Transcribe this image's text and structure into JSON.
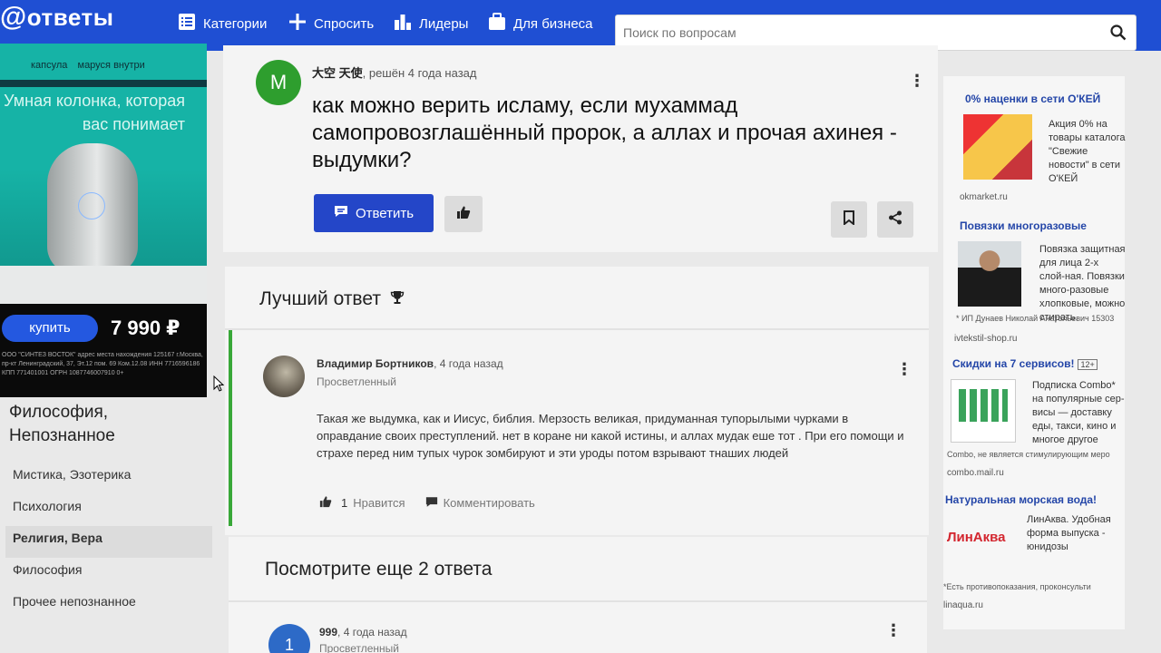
{
  "header": {
    "logo_symbol": "@",
    "logo_text": "ответы",
    "nav": [
      {
        "label": "Категории",
        "icon": "list-icon"
      },
      {
        "label": "Спросить",
        "icon": "plus-icon"
      },
      {
        "label": "Лидеры",
        "icon": "bars-icon"
      },
      {
        "label": "Для бизнеса",
        "icon": "briefcase-icon"
      }
    ],
    "search_placeholder": "Поиск по вопросам",
    "accent": "#1f4fd3"
  },
  "left_ad": {
    "brand1": "капсула",
    "brand2": "маруся внутри",
    "title": "Умная колонка, которая вас понимает",
    "buy_label": "купить",
    "price": "7 990 ₽",
    "legal": "ООО \"СИНТЕЗ ВОСТОК\" адрес места нахождения 125167 г.Москва, пр-кт Ленинградский, 37, Эт.12 пом. 69 Ком.12.08 ИНН 7716596186 КПП 771401001 ОГРН 1087746007910 0+"
  },
  "categories": {
    "heading": "Философия, Непознанное",
    "items": [
      {
        "label": "Мистика, Эзотерика",
        "active": false
      },
      {
        "label": "Психология",
        "active": false
      },
      {
        "label": "Религия, Вера",
        "active": true
      },
      {
        "label": "Философия",
        "active": false
      },
      {
        "label": "Прочее непознанное",
        "active": false
      }
    ]
  },
  "question": {
    "avatar_letter": "M",
    "author": "大空 天使",
    "meta": ", решён 4 года назад",
    "title": "как можно верить исламу, если мухаммад самопровозглашённый пророк, а аллах и прочая ахинея - выдумки?",
    "answer_button": "Ответить"
  },
  "best_answer": {
    "heading": "Лучший ответ",
    "author": "Владимир Бортников",
    "time": ", 4 года назад",
    "rank": "Просветленный",
    "text": "Такая же выдумка, как и Иисус, библия. Мерзость великая, придуманная тупорылыми чурками в оправдание своих преступлений. нет в коране ни какой истины, и аллах мудак еше тот . При его помощи и страхе перед ним тупых чурок зомбируют и эти уроды потом взрывают тнаших людей",
    "likes": "1",
    "like_label": "Нравится",
    "comment_label": "Комментировать"
  },
  "more_answers": {
    "heading": "Посмотрите еще 2 ответа",
    "first": {
      "avatar_number": "1",
      "author": "999",
      "time": ", 4 года назад",
      "rank": "Просветленный"
    }
  },
  "right_ads": [
    {
      "title": "0% наценки в сети О'КЕЙ",
      "text": "Акция 0% на товары каталога \"Свежие новости\" в сети О'КЕЙ",
      "domain": "okmarket.ru"
    },
    {
      "title": "Повязки многоразовые",
      "text": "Повязка защитная для лица 2-х слой-ная. Повязки много-разовые хлопковые, можно стирать.",
      "note": "* ИП Дунаев Николай Анатольевич 15303",
      "domain": "ivtekstil-shop.ru"
    },
    {
      "title": "Скидки на 7 сервисов!",
      "age": "12+",
      "text": "Подписка Combo* на популярные сер-висы — доставку еды, такси, кино и многое другое",
      "note": "Combo, не является стимулирующим меро",
      "domain": "combo.mail.ru"
    },
    {
      "title": "Натуральная морская вода!",
      "logo": "ЛинАква",
      "text": "ЛинАква. Удобная форма выпуска - юнидозы",
      "note": "*Есть противопоказания, проконсульти",
      "domain": "linaqua.ru"
    }
  ]
}
